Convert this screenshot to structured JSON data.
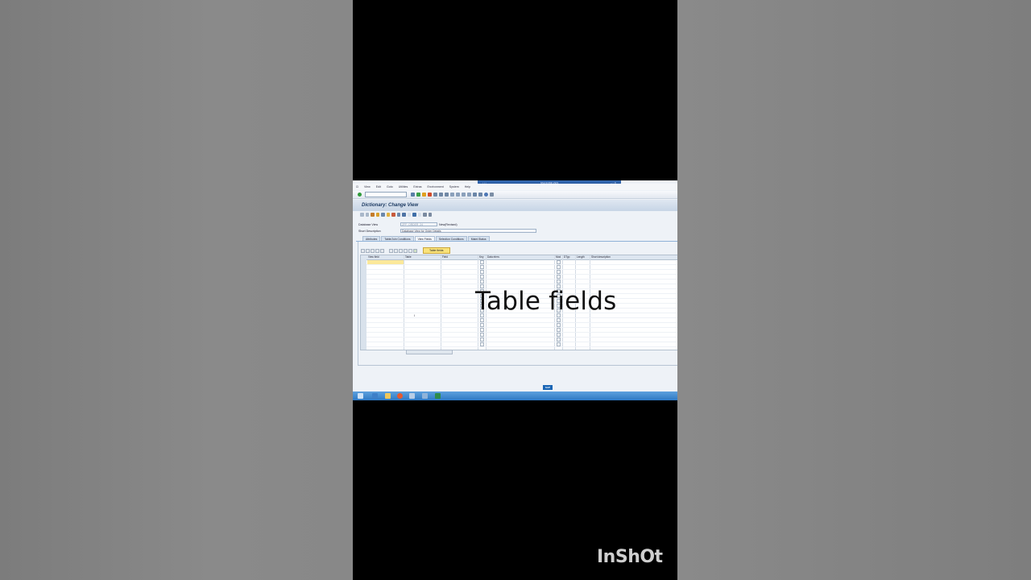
{
  "window": {
    "title": "NS4(1)/800 ZW1"
  },
  "menu": [
    "View",
    "Edit",
    "Goto",
    "Utilities",
    "Extras",
    "Environment",
    "System",
    "Help"
  ],
  "screen": {
    "title": "Dictionary: Change View"
  },
  "fields": {
    "database_view_label": "Database View",
    "database_view_value": "ZFF_ORDER_24",
    "database_view_status": "New(Revised)",
    "short_description_label": "Short Description",
    "short_description_value": "Database View for Order Details"
  },
  "tabs": [
    "Attributes",
    "Table/Join Conditions",
    "View Fields",
    "Selection Conditions",
    "Maint.Status"
  ],
  "active_tab": "View Fields",
  "grid": {
    "table_fields_button": "Table fields",
    "columns": [
      "View field",
      "Table",
      "Field",
      "Key",
      "Data elem.",
      "Mod",
      "DTyp",
      "Length",
      "Short description"
    ],
    "cursor_text": "I"
  },
  "sap_logo": "SAP",
  "overlay_caption": "Table fields",
  "watermark": "InShOt",
  "colors": {
    "accent": "#1b66b5",
    "highlight": "#fbe89a",
    "taskbar": "#2e79c4"
  }
}
